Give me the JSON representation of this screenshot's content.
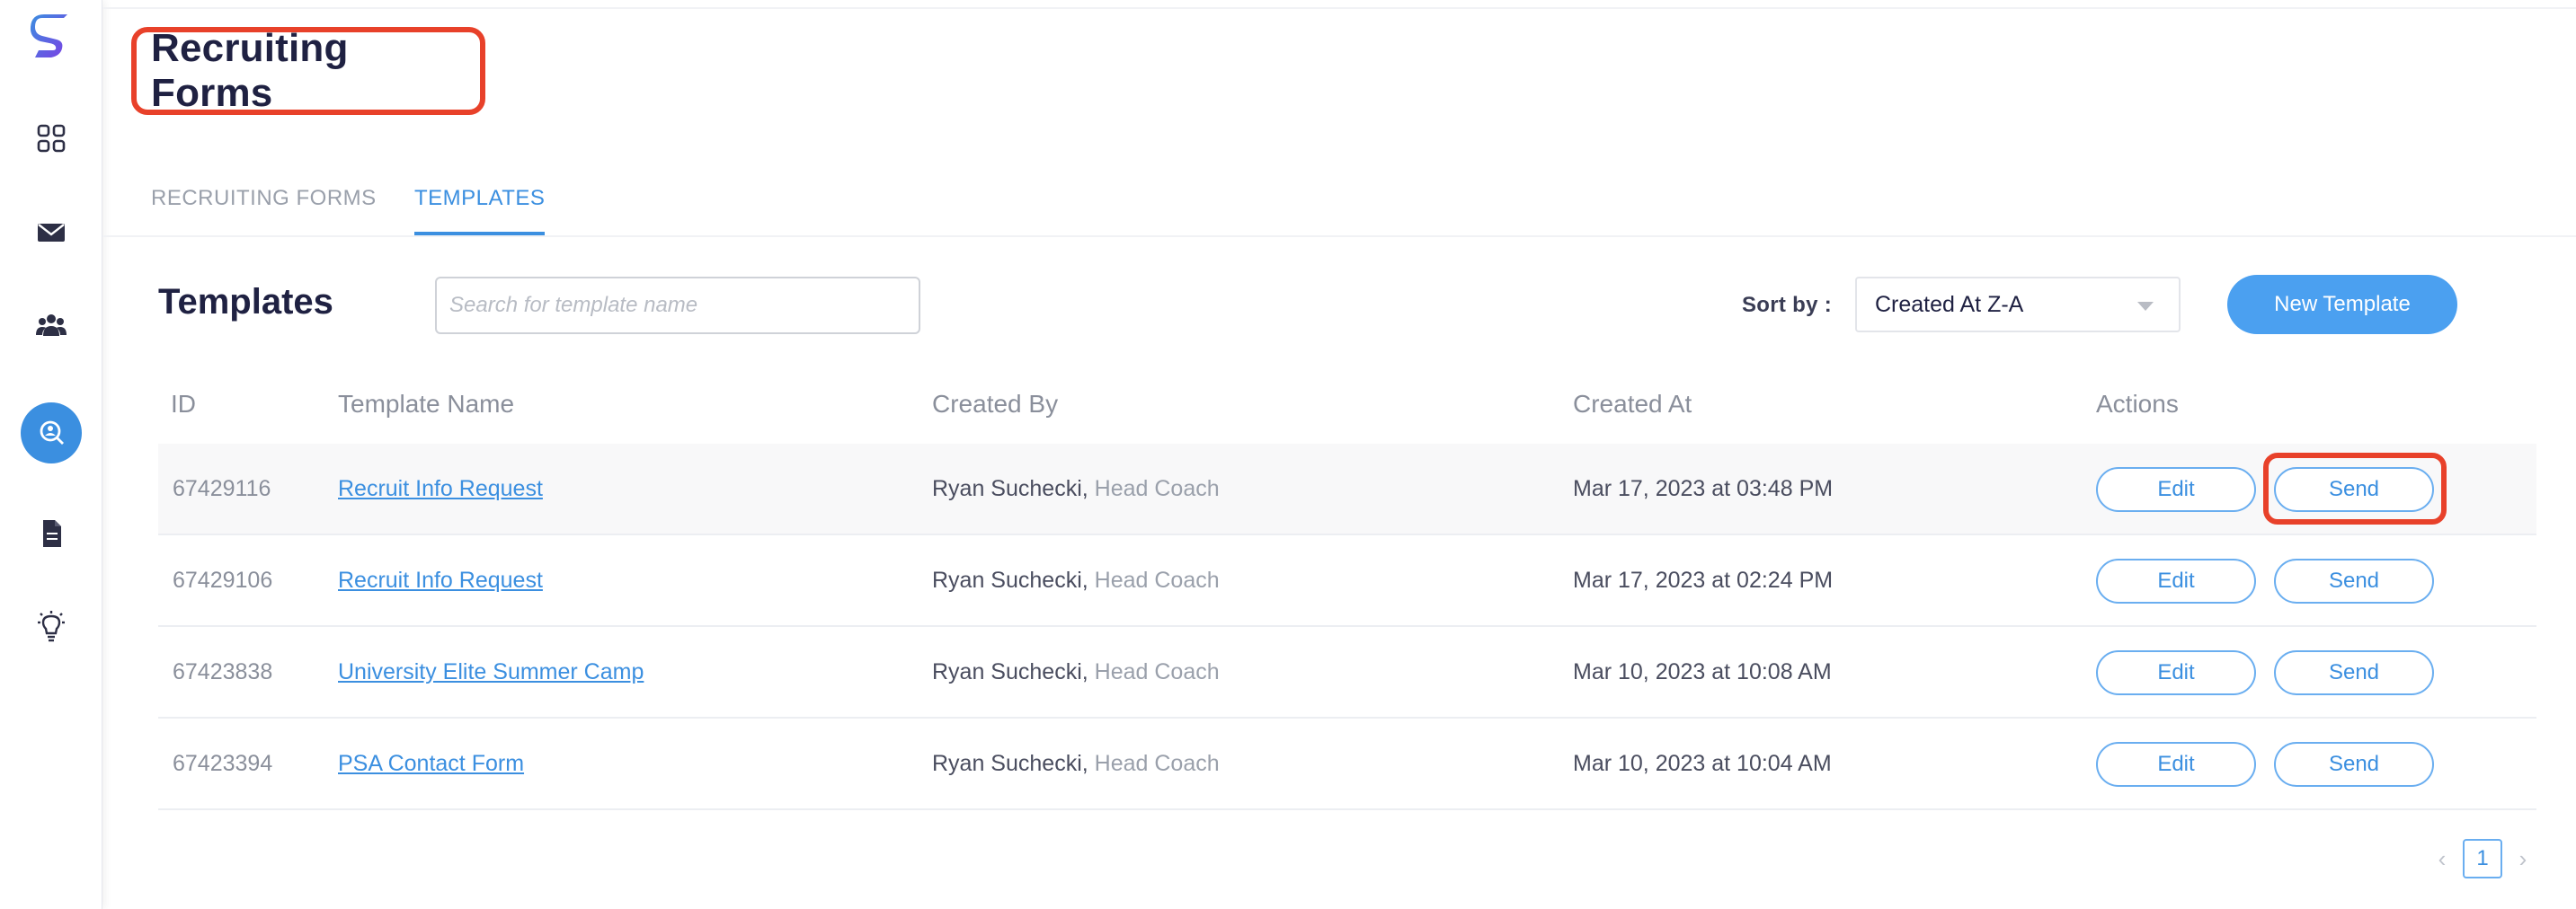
{
  "sidebar": {
    "logo": "scorestream-logo",
    "items": [
      {
        "icon": "dashboard-grid-icon"
      },
      {
        "icon": "mail-icon"
      },
      {
        "icon": "team-icon"
      },
      {
        "icon": "recruit-search-icon",
        "active": true
      },
      {
        "icon": "document-icon"
      },
      {
        "icon": "lightbulb-icon"
      }
    ]
  },
  "header": {
    "title": "Recruiting Forms"
  },
  "tabs": [
    {
      "label": "RECRUITING FORMS",
      "active": false
    },
    {
      "label": "TEMPLATES",
      "active": true
    }
  ],
  "toolbar": {
    "section_title": "Templates",
    "search_placeholder": "Search for template name",
    "search_value": "",
    "sort_label": "Sort by :",
    "sort_value": "Created At Z-A",
    "new_button": "New Template"
  },
  "table": {
    "columns": [
      "ID",
      "Template Name",
      "Created By",
      "Created At",
      "Actions"
    ],
    "rows": [
      {
        "id": "67429116",
        "name": "Recruit Info Request",
        "creator": "Ryan Suchecki,",
        "role": "Head Coach",
        "created_at": "Mar 17, 2023 at 03:48 PM"
      },
      {
        "id": "67429106",
        "name": "Recruit Info Request",
        "creator": "Ryan Suchecki,",
        "role": "Head Coach",
        "created_at": "Mar 17, 2023 at 02:24 PM"
      },
      {
        "id": "67423838",
        "name": "University Elite Summer Camp",
        "creator": "Ryan Suchecki,",
        "role": "Head Coach",
        "created_at": "Mar 10, 2023 at 10:08 AM"
      },
      {
        "id": "67423394",
        "name": "PSA Contact Form",
        "creator": "Ryan Suchecki,",
        "role": "Head Coach",
        "created_at": "Mar 10, 2023 at 10:04 AM"
      }
    ],
    "edit_label": "Edit",
    "send_label": "Send"
  },
  "pagination": {
    "prev": "‹",
    "current": "1",
    "next": "›"
  },
  "colors": {
    "accent": "#3b8fe0",
    "highlight": "#e8412a",
    "title": "#1f2142"
  }
}
